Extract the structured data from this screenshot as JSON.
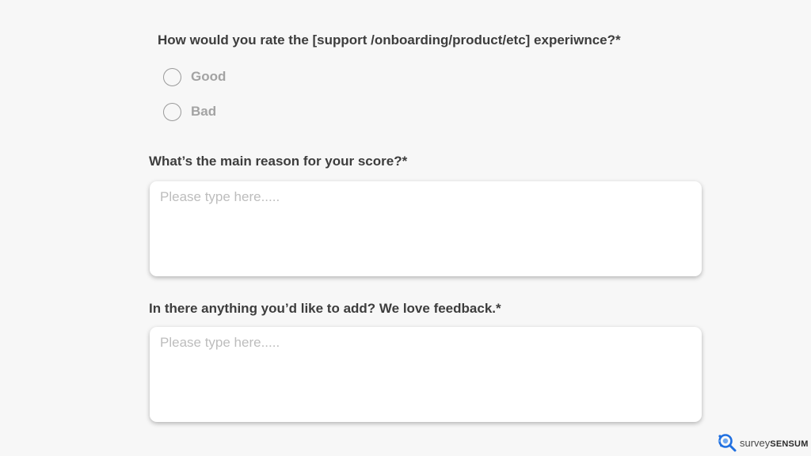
{
  "form": {
    "q1": {
      "title": "How would you rate the [support /onboarding/product/etc] experiwnce?*",
      "options": [
        {
          "label": "Good",
          "selected": false
        },
        {
          "label": "Bad",
          "selected": false
        }
      ]
    },
    "q2": {
      "title": "What’s the main reason for your score?*",
      "placeholder": "Please type here.....",
      "value": ""
    },
    "q3": {
      "title": "In there anything you’d like to add? We love feedback.*",
      "placeholder": "Please type here.....",
      "value": ""
    }
  },
  "branding": {
    "word1": "survey",
    "word2": "SENSUM",
    "logo_icon": "search-magnifier-icon",
    "accent_color": "#1f6fe0"
  },
  "colors": {
    "background": "#f7f7f7",
    "question_text": "#3d3d3d",
    "option_text": "#a3a3a3",
    "placeholder": "#bdbdbd"
  }
}
